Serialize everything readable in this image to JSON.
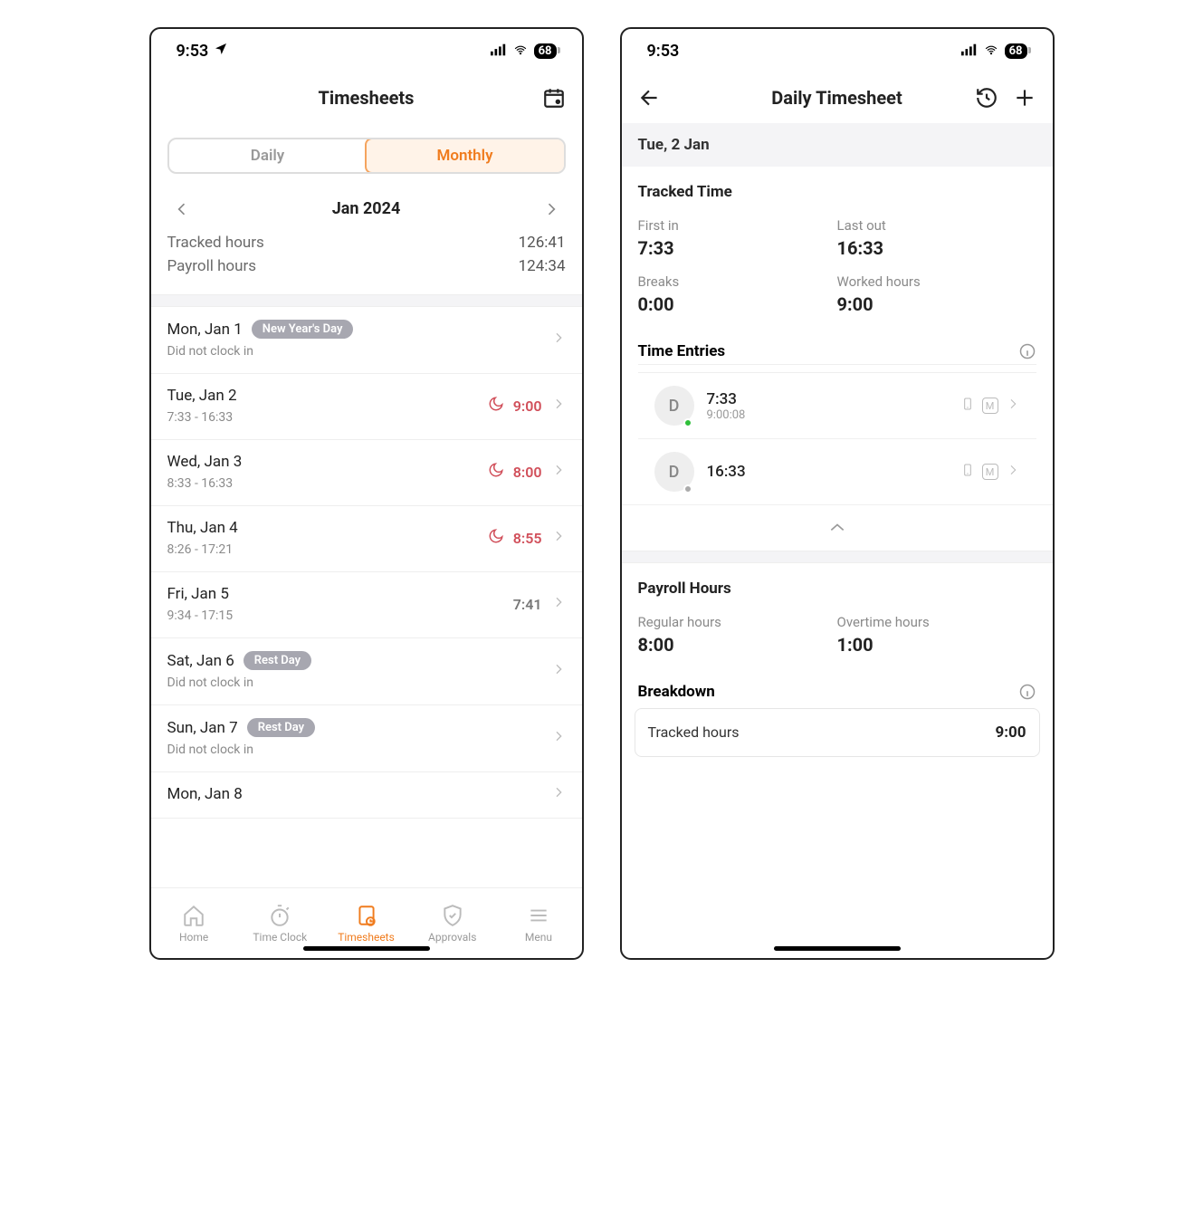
{
  "statusbar": {
    "time": "9:53",
    "battery": "68"
  },
  "screen_a": {
    "title": "Timesheets",
    "seg_daily": "Daily",
    "seg_monthly": "Monthly",
    "month": "Jan 2024",
    "summary": {
      "tracked_label": "Tracked hours",
      "tracked_value": "126:41",
      "payroll_label": "Payroll hours",
      "payroll_value": "124:34"
    },
    "days": [
      {
        "date": "Mon, Jan 1",
        "badge": "New Year's Day",
        "sub": "Did not clock in",
        "hours": "",
        "moon": false,
        "red": false
      },
      {
        "date": "Tue, Jan 2",
        "badge": "",
        "sub": "7:33 - 16:33",
        "hours": "9:00",
        "moon": true,
        "red": true
      },
      {
        "date": "Wed, Jan 3",
        "badge": "",
        "sub": "8:33 - 16:33",
        "hours": "8:00",
        "moon": true,
        "red": true
      },
      {
        "date": "Thu, Jan 4",
        "badge": "",
        "sub": "8:26 - 17:21",
        "hours": "8:55",
        "moon": true,
        "red": true
      },
      {
        "date": "Fri, Jan 5",
        "badge": "",
        "sub": "9:34 - 17:15",
        "hours": "7:41",
        "moon": false,
        "red": false
      },
      {
        "date": "Sat, Jan 6",
        "badge": "Rest Day",
        "sub": "Did not clock in",
        "hours": "",
        "moon": false,
        "red": false
      },
      {
        "date": "Sun, Jan 7",
        "badge": "Rest Day",
        "sub": "Did not clock in",
        "hours": "",
        "moon": false,
        "red": false
      },
      {
        "date": "Mon, Jan 8",
        "badge": "",
        "sub": "",
        "hours": "",
        "moon": false,
        "red": false
      }
    ],
    "tabs": {
      "home": "Home",
      "timeclock": "Time Clock",
      "timesheets": "Timesheets",
      "approvals": "Approvals",
      "menu": "Menu"
    }
  },
  "screen_b": {
    "title": "Daily Timesheet",
    "date": "Tue, 2 Jan",
    "tracked_heading": "Tracked Time",
    "kv": {
      "first_in_l": "First in",
      "first_in_v": "7:33",
      "last_out_l": "Last out",
      "last_out_v": "16:33",
      "breaks_l": "Breaks",
      "breaks_v": "0:00",
      "worked_l": "Worked hours",
      "worked_v": "9:00"
    },
    "entries_heading": "Time Entries",
    "entries": [
      {
        "avatar": "D",
        "time": "7:33",
        "sub": "9:00:08",
        "dot": "green"
      },
      {
        "avatar": "D",
        "time": "16:33",
        "sub": "",
        "dot": "gray"
      }
    ],
    "entry_m": "M",
    "payroll_heading": "Payroll Hours",
    "pkv": {
      "reg_l": "Regular hours",
      "reg_v": "8:00",
      "ot_l": "Overtime hours",
      "ot_v": "1:00"
    },
    "breakdown_heading": "Breakdown",
    "breakdown_l": "Tracked hours",
    "breakdown_v": "9:00"
  }
}
